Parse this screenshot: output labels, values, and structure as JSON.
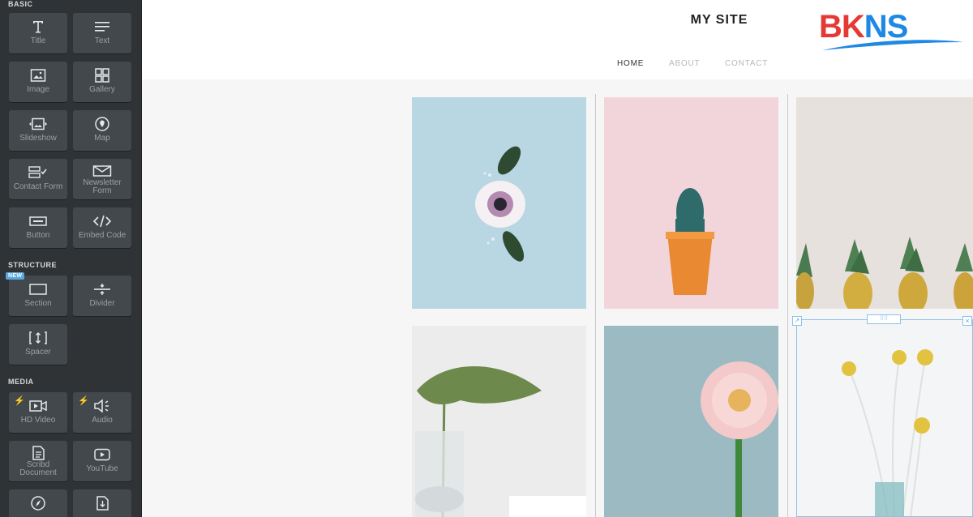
{
  "sidebar": {
    "sections": {
      "basic": "BASIC",
      "structure": "STRUCTURE",
      "media": "MEDIA"
    },
    "new_badge": "NEW",
    "items": {
      "title": "Title",
      "text": "Text",
      "image": "Image",
      "gallery": "Gallery",
      "slideshow": "Slideshow",
      "map": "Map",
      "contact_form": "Contact Form",
      "newsletter_form_1": "Newsletter",
      "newsletter_form_2": "Form",
      "button": "Button",
      "embed_code": "Embed Code",
      "section": "Section",
      "divider": "Divider",
      "spacer": "Spacer",
      "hd_video": "HD Video",
      "audio": "Audio",
      "scribd_1": "Scribd",
      "scribd_2": "Document",
      "youtube": "YouTube"
    }
  },
  "site": {
    "title": "MY SITE",
    "nav": {
      "home": "HOME",
      "about": "ABOUT",
      "contact": "CONTACT"
    },
    "logo": {
      "part1": "BK",
      "part2": "NS"
    }
  },
  "gallery": {
    "photos": [
      "flower-on-blue",
      "cactus-on-pink",
      "pineapples",
      "monstera-leaf",
      "pink-gerbera",
      "yellow-craspedia"
    ]
  },
  "colors": {
    "sidebar_bg": "#2f3336",
    "tile_bg": "#43484c",
    "accent": "#5aa7e0",
    "bolt": "#f5a623",
    "logo_red": "#e53935",
    "logo_blue": "#1e88e5"
  }
}
